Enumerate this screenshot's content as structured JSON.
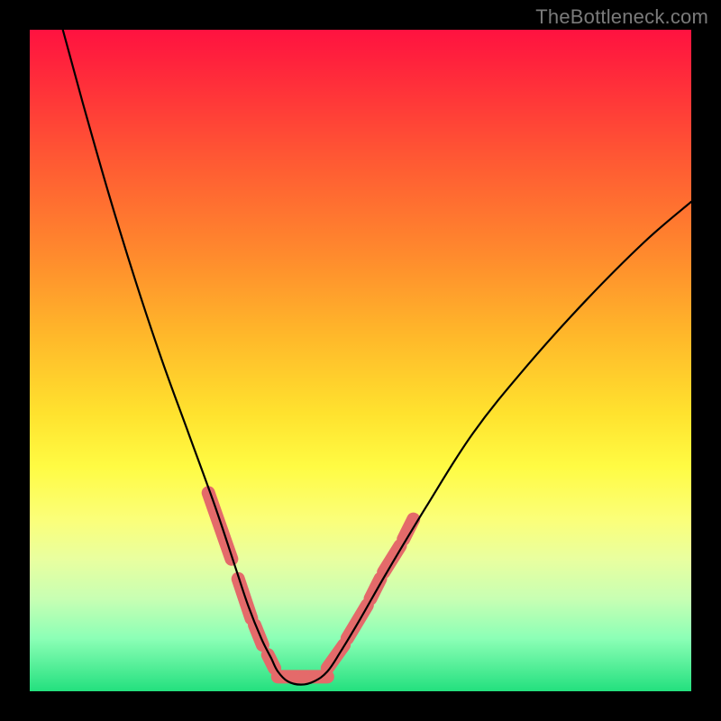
{
  "watermark": {
    "text": "TheBottleneck.com"
  },
  "colors": {
    "bg": "#000000",
    "curve": "#000000",
    "marker": "#e46a6a",
    "gradient_top": "#ff1240",
    "gradient_bottom": "#23e07e"
  },
  "chart_data": {
    "type": "line",
    "title": "",
    "xlabel": "",
    "ylabel": "",
    "xlim": [
      0,
      100
    ],
    "ylim": [
      0,
      100
    ],
    "grid": false,
    "legend": false,
    "series": [
      {
        "name": "left-branch",
        "x": [
          5,
          8,
          12,
          16,
          20,
          24,
          28,
          31,
          33,
          35,
          36.5,
          37.5
        ],
        "y": [
          100,
          89,
          75,
          62,
          50,
          39,
          28,
          19,
          13,
          8,
          5,
          3
        ]
      },
      {
        "name": "valley",
        "x": [
          37.5,
          39,
          41,
          43,
          45
        ],
        "y": [
          3,
          1.5,
          1,
          1.5,
          3
        ]
      },
      {
        "name": "right-branch",
        "x": [
          45,
          47,
          50,
          54,
          60,
          67,
          75,
          84,
          93,
          100
        ],
        "y": [
          3,
          6,
          11,
          18,
          28,
          39,
          49,
          59,
          68,
          74
        ]
      }
    ],
    "markers": {
      "name": "highlight-segments",
      "color": "#e46a6a",
      "segments": [
        {
          "x": [
            27,
            30.5
          ],
          "y": [
            30,
            20
          ]
        },
        {
          "x": [
            31.5,
            33.5
          ],
          "y": [
            17,
            11
          ]
        },
        {
          "x": [
            34,
            35.2
          ],
          "y": [
            10,
            7
          ]
        },
        {
          "x": [
            36,
            37
          ],
          "y": [
            5.5,
            3.5
          ]
        },
        {
          "x": [
            37.5,
            45
          ],
          "y": [
            2.2,
            2.2
          ]
        },
        {
          "x": [
            45,
            47.5
          ],
          "y": [
            3.5,
            7
          ]
        },
        {
          "x": [
            48,
            51
          ],
          "y": [
            8,
            13
          ]
        },
        {
          "x": [
            51.5,
            53
          ],
          "y": [
            14,
            17
          ]
        },
        {
          "x": [
            53.5,
            56
          ],
          "y": [
            18,
            22
          ]
        },
        {
          "x": [
            56.5,
            58
          ],
          "y": [
            23,
            26
          ]
        }
      ]
    }
  }
}
